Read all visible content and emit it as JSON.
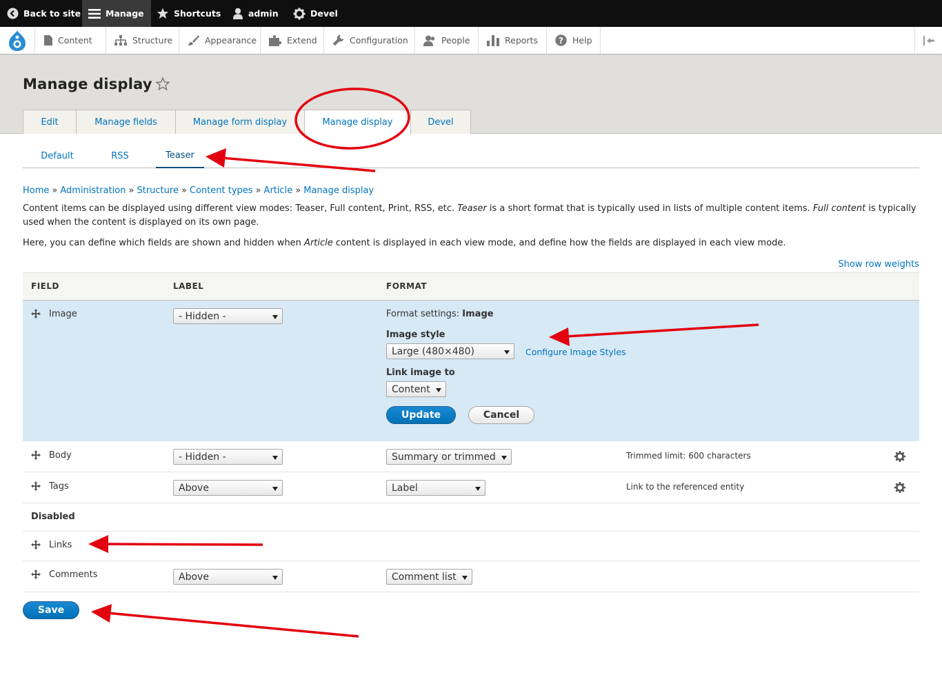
{
  "toolbar": {
    "back_to_site": "Back to site",
    "manage": "Manage",
    "shortcuts": "Shortcuts",
    "user": "admin",
    "devel": "Devel"
  },
  "tray": {
    "items": [
      "Content",
      "Structure",
      "Appearance",
      "Extend",
      "Configuration",
      "People",
      "Reports",
      "Help"
    ]
  },
  "page": {
    "title": "Manage display"
  },
  "tabs": [
    "Edit",
    "Manage fields",
    "Manage form display",
    "Manage display",
    "Devel"
  ],
  "subtabs": [
    "Default",
    "RSS",
    "Teaser"
  ],
  "breadcrumb": [
    "Home",
    "Administration",
    "Structure",
    "Content types",
    "Article",
    "Manage display"
  ],
  "breadcrumb_sep": "»",
  "description": {
    "p1_a": "Content items can be displayed using different view modes: Teaser, Full content, Print, RSS, etc. ",
    "p1_teaser": "Teaser",
    "p1_b": " is a short format that is typically used in lists of multiple content items. ",
    "p1_full": "Full content",
    "p1_c": " is typically used when the content is displayed on its own page.",
    "p2_a": "Here, you can define which fields are shown and hidden when ",
    "p2_article": "Article",
    "p2_b": " content is displayed in each view mode, and define how the fields are displayed in each view mode."
  },
  "show_row_weights": "Show row weights",
  "table": {
    "headers": {
      "field": "FIELD",
      "label": "LABEL",
      "format": "FORMAT"
    },
    "image": {
      "name": "Image",
      "label": "- Hidden -",
      "settings_prefix": "Format settings: ",
      "settings_name": "Image",
      "image_style_label": "Image style",
      "image_style_value": "Large (480×480)",
      "configure_link": "Configure Image Styles",
      "link_to_label": "Link image to",
      "link_to_value": "Content",
      "update": "Update",
      "cancel": "Cancel"
    },
    "body": {
      "name": "Body",
      "label": "- Hidden -",
      "format": "Summary or trimmed",
      "summary": "Trimmed limit: 600 characters"
    },
    "tags": {
      "name": "Tags",
      "label": "Above",
      "format": "Label",
      "summary": "Link to the referenced entity"
    },
    "disabled_heading": "Disabled",
    "links": {
      "name": "Links"
    },
    "comments": {
      "name": "Comments",
      "label": "Above",
      "format": "Comment list"
    }
  },
  "save": "Save",
  "colors": {
    "link": "#0074bd",
    "primary_button": "#0071b8",
    "selected_row": "#d7e9f5",
    "annotation": "#e3000f",
    "toolbar": "#0f0f0f"
  }
}
